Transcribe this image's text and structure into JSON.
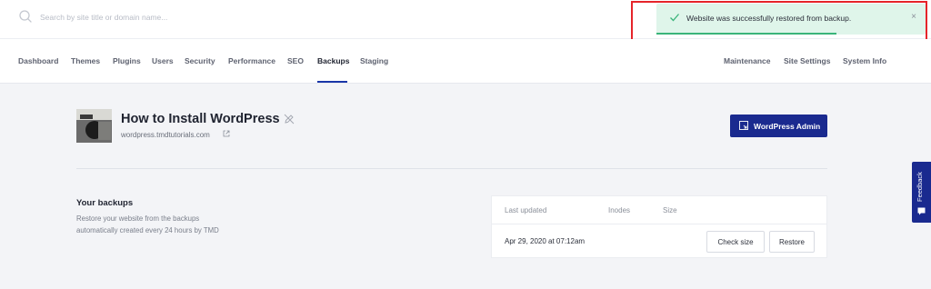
{
  "search": {
    "placeholder": "Search by site title or domain name..."
  },
  "toast": {
    "message": "Website was successfully restored from backup.",
    "close_label": "×",
    "progress": 0.67,
    "accent": "#3ab47a",
    "background": "#dff5ea"
  },
  "nav": {
    "left": [
      "Dashboard",
      "Themes",
      "Plugins",
      "Users",
      "Security",
      "Performance",
      "SEO",
      "Backups",
      "Staging"
    ],
    "active": "Backups",
    "right": [
      "Maintenance",
      "Site Settings",
      "System Info"
    ]
  },
  "site": {
    "title": "How to Install WordPress",
    "domain": "wordpress.tmdtutorials.com"
  },
  "wp_admin_button": {
    "label": "WordPress Admin",
    "color": "#1a2a8f"
  },
  "backups": {
    "heading": "Your backups",
    "description": "Restore your website from the backups automatically created every 24 hours by TMD",
    "columns": [
      "Last updated",
      "Inodes",
      "Size"
    ],
    "rows": [
      {
        "last_updated": "Apr 29, 2020 at 07:12am",
        "inodes": "",
        "size": ""
      }
    ],
    "check_size_label": "Check size",
    "restore_label": "Restore"
  },
  "feedback": {
    "label": "Feedback"
  },
  "colors": {
    "brand": "#1a2a8f",
    "highlight": "#e5242a"
  }
}
